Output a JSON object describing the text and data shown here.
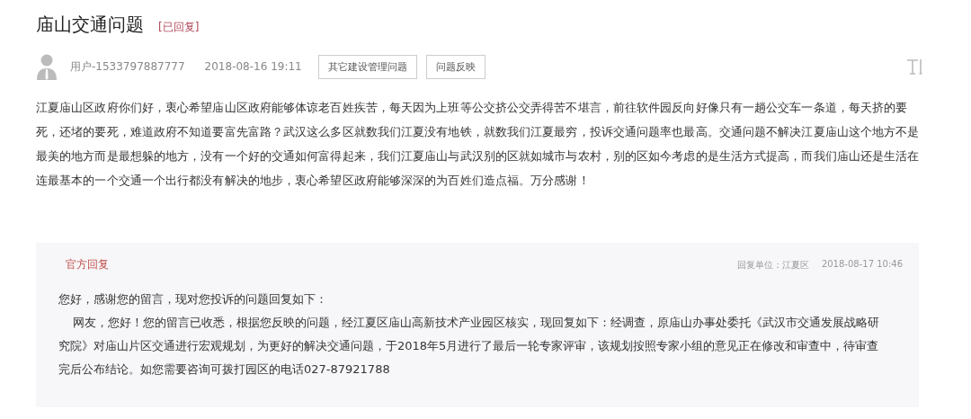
{
  "question": {
    "title": "庙山交通问题",
    "status": "[已回复]",
    "user": "用户-1533797887777",
    "time": "2018-08-16 19:11",
    "tags": [
      {
        "label": "其它建设管理问题"
      },
      {
        "label": "问题反映"
      }
    ],
    "body": "江夏庙山区政府你们好，衷心希望庙山区政府能够体谅老百姓疾苦，每天因为上班等公交挤公交弄得苦不堪言，前往软件园反向好像只有一趟公交车一条道，每天挤的要死，还堵的要死，难道政府不知道要富先富路？武汉这么多区就数我们江夏没有地铁，就数我们江夏最穷，投诉交通问题率也最高。交通问题不解决江夏庙山这个地方不是最美的地方而是最想躲的地方，没有一个好的交通如何富得起来，我们江夏庙山与武汉别的区就如城市与农村，别的区如今考虑的是生活方式提高，而我们庙山还是生活在连最基本的一个交通一个出行都没有解决的地步，衷心希望区政府能够深深的为百姓们造点福。万分感谢！"
  },
  "reply": {
    "heading": "官方回复",
    "unit": "回复单位：江夏区",
    "time": "2018-08-17 10:46",
    "paragraphs": [
      {
        "text": "您好，感谢您的留言，现对您投诉的问题回复如下：",
        "indented": false
      },
      {
        "text": "网友，您好！您的留言已收悉，根据您反映的问题，经江夏区庙山高新技术产业园区核实，现回复如下：经调查，原庙山办事处委托《武汉市交通发展战略研究院》对庙山片区交通进行宏观规划，为更好的解决交通问题，于2018年5月进行了最后一轮专家评审，该规划按照专家小组的意见正在修改和审查中，待审查完后公布结论。如您需要咨询可拨打园区的电话027-87921788",
        "indented": true
      }
    ]
  }
}
